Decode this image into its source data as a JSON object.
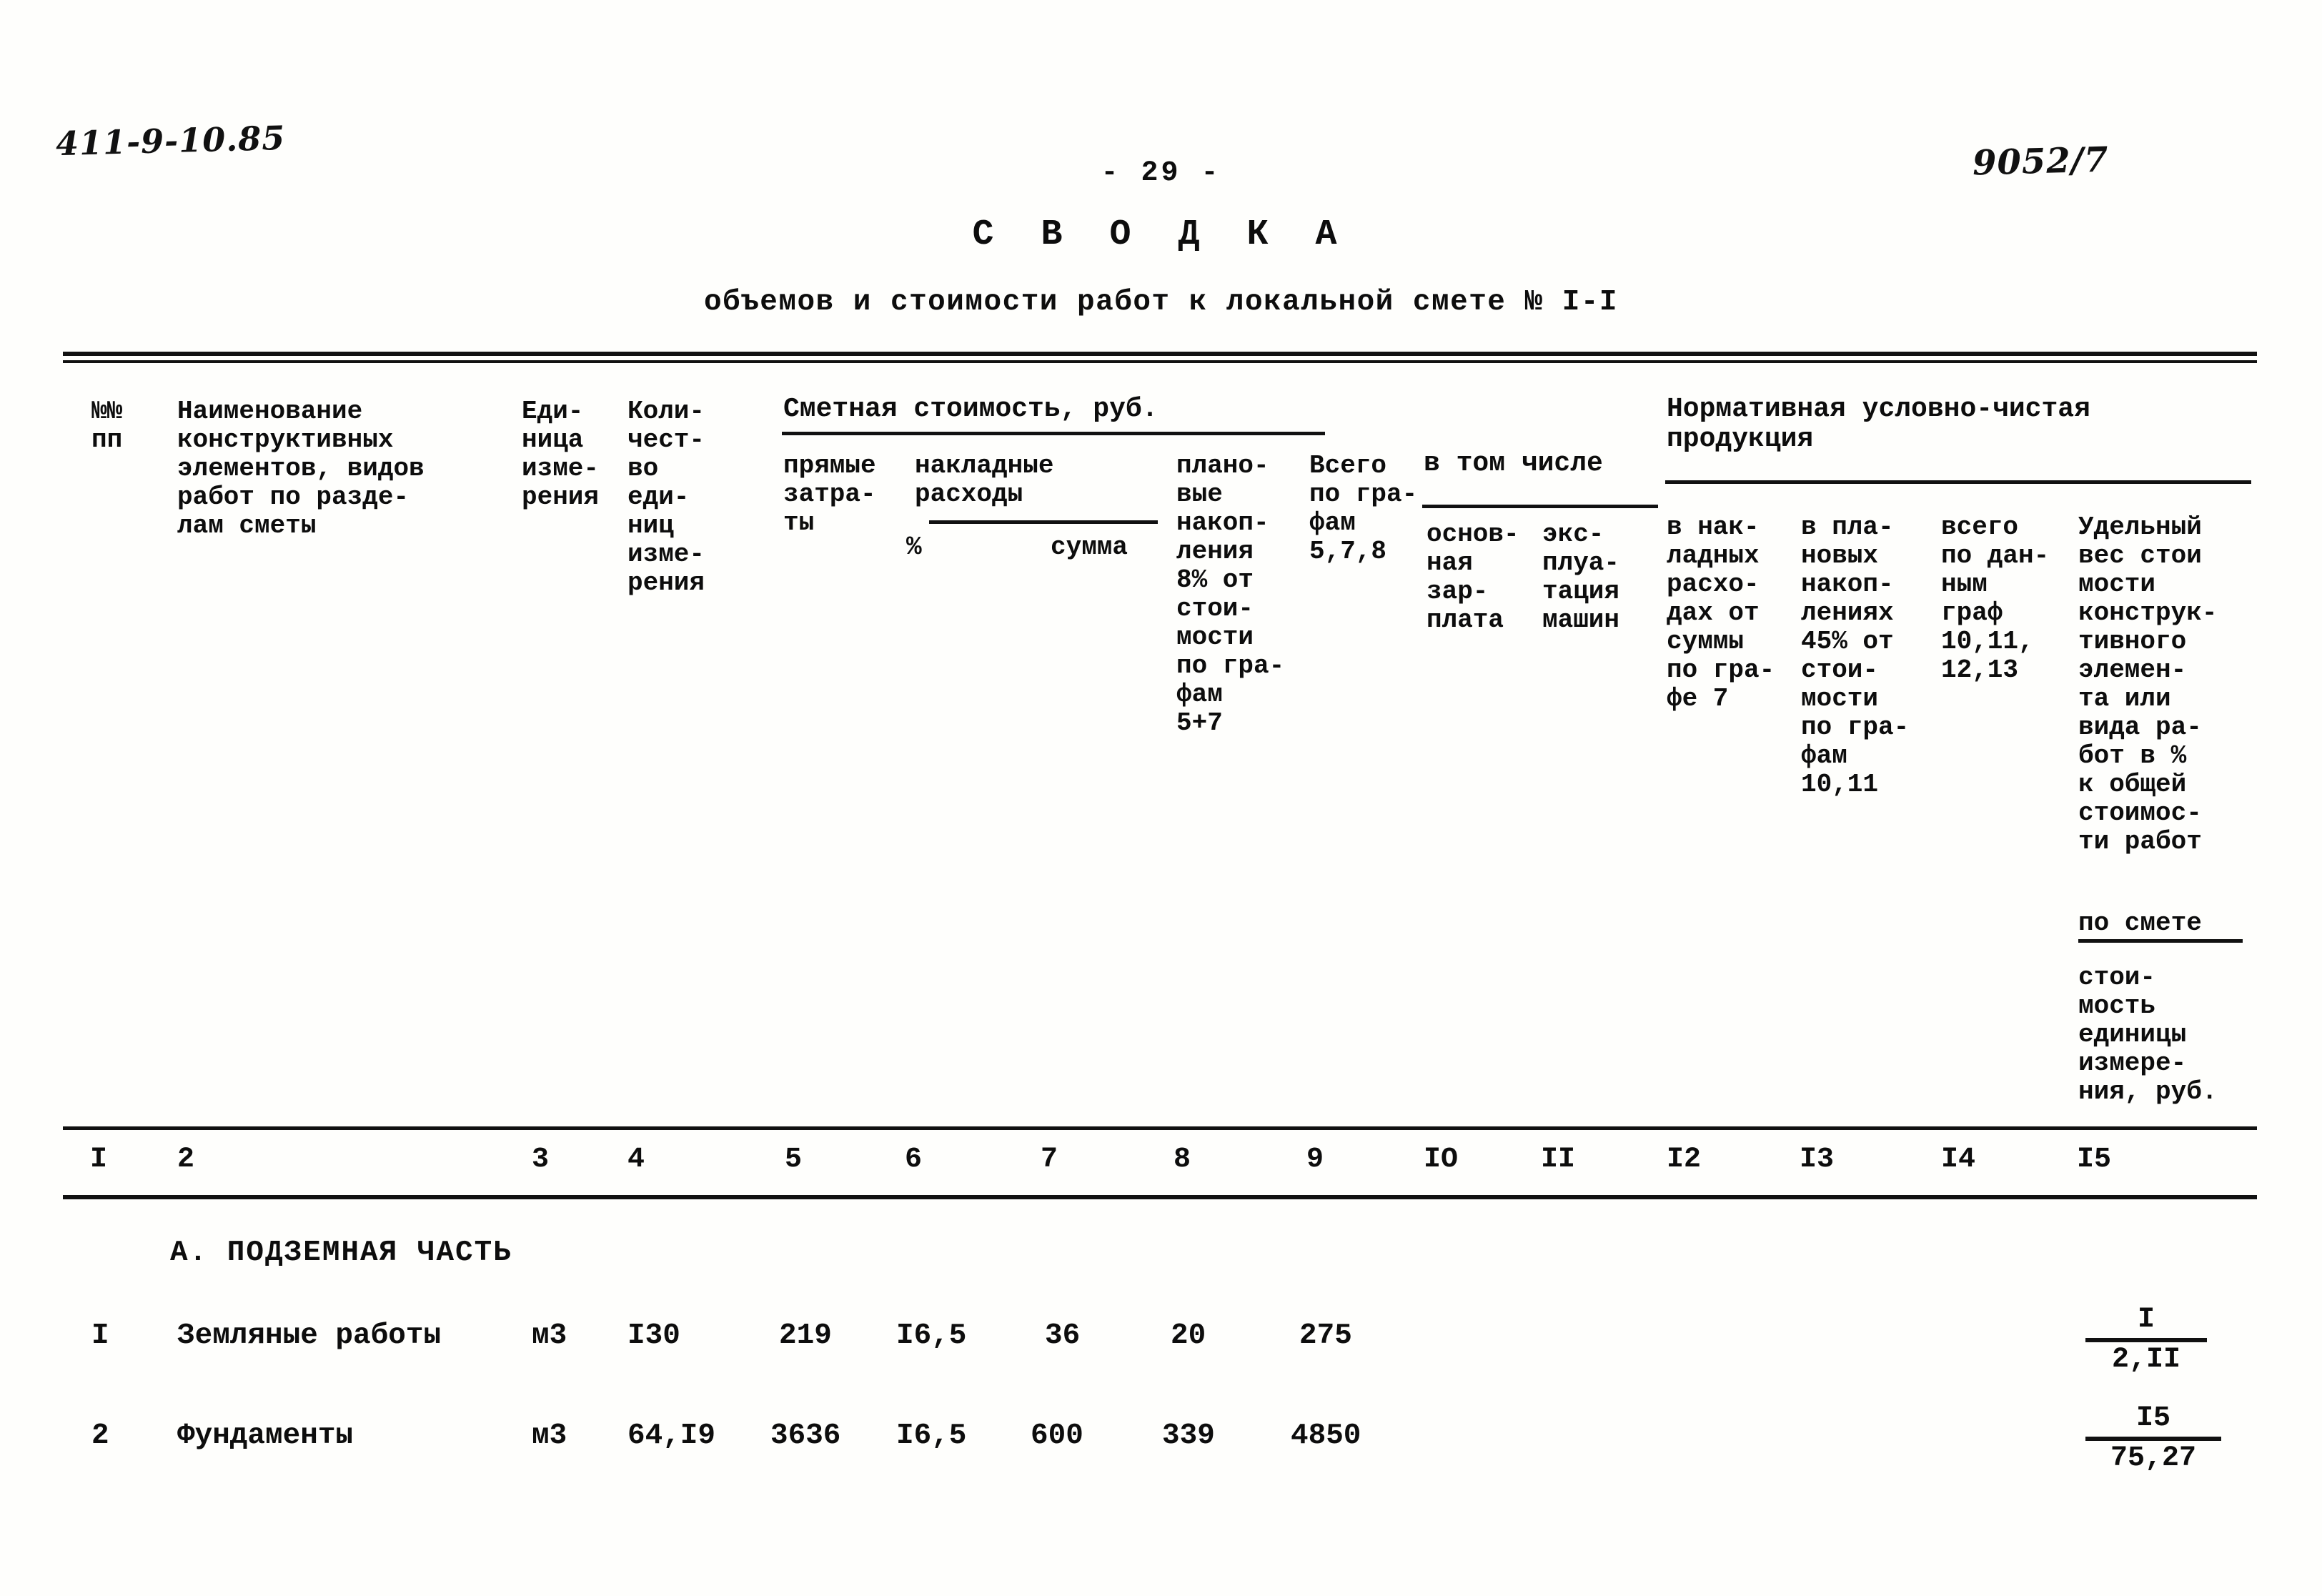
{
  "handwritten": {
    "top_left": "411-9-10.85",
    "top_right": "9052/7"
  },
  "page_number": "- 29 -",
  "title": "С В О Д К А",
  "subtitle": "объемов и стоимости работ к локальной смете № I-I",
  "header": {
    "col1": "№№\nпп",
    "col2": "Наименование\nконструктивных\nэлементов, видов\nработ по разде-\nлам сметы",
    "col3": "Еди-\nница\nизме-\nрения",
    "col4": "Коли-\nчест-\nво\nеди-\nниц\nизме-\nрения",
    "group_smetnaya": "Сметная стоимость, руб.",
    "col5": "прямые\nзатра-\nты",
    "col6_7_label": "накладные\nрасходы",
    "col6": "%",
    "col7": "сумма",
    "col8": "плано-\nвые\nнакоп-\nления\n8% от\nстои-\nмости\nпо гра-\nфам\n5+7",
    "col9": "Всего\nпо гра-\nфам\n5,7,8",
    "group_vtomchisle": "в том числе",
    "col10": "основ-\nная\nзар-\nплата",
    "col11": "экс-\nплуа-\nтация\nмашин",
    "group_nuchp": "Нормативная условно-чистая\nпродукция",
    "col12": "в нак-\nладных\nрасхо-\nдах от\nсуммы\nпо гра-\nфе 7",
    "col13": "в пла-\nновых\nнакоп-\nлениях\n45% от\nстои-\nмости\nпо гра-\nфам\n10,11",
    "col14": "всего\nпо дан-\nным\nграф\n10,11,\n12,13",
    "col15_a": "Удельный\nвес стои\nмости\nконструк-\nтивного\nэлемен-\nта или\nвида ра-\nбот в %\nк общей\nстоимос-\nти работ",
    "col15_a_underlined": "по смете",
    "col15_b": "стои-\nмость\nединицы\nизмере-\nния, руб."
  },
  "column_numbers": [
    "I",
    "2",
    "3",
    "4",
    "5",
    "6",
    "7",
    "8",
    "9",
    "IO",
    "II",
    "I2",
    "I3",
    "I4",
    "I5"
  ],
  "section": "А. ПОДЗЕМНАЯ ЧАСТЬ",
  "rows": [
    {
      "no": "I",
      "name": "Земляные работы",
      "unit": "м3",
      "qty": "I30",
      "direct": "219",
      "overhead_pct": "I6,5",
      "overhead_sum": "36",
      "planned": "20",
      "total": "275",
      "main_salary": "",
      "machines": "",
      "nuchp_overhead": "",
      "nuchp_planned": "",
      "nuchp_total": "",
      "share_num": "I",
      "share_den": "2,II"
    },
    {
      "no": "2",
      "name": "Фундаменты",
      "unit": "м3",
      "qty": "64,I9",
      "direct": "3636",
      "overhead_pct": "I6,5",
      "overhead_sum": "600",
      "planned": "339",
      "total": "4850",
      "main_salary": "",
      "machines": "",
      "nuchp_overhead": "",
      "nuchp_planned": "",
      "nuchp_total": "",
      "share_num": "I5",
      "share_den": "75,27"
    }
  ]
}
